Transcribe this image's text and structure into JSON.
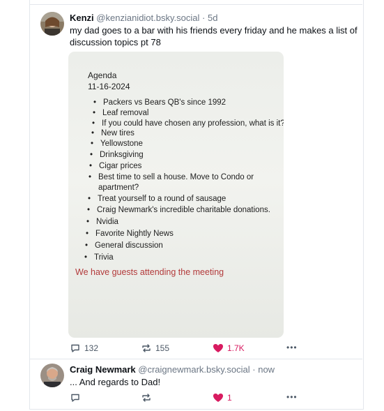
{
  "post": {
    "display_name": "Kenzi",
    "handle": "@kenzianidiot.bsky.social",
    "separator": "·",
    "time": "5d",
    "text_line1": "my dad goes to a bar with his friends every friday and he makes a list of",
    "text_line2": "discussion topics pt 78",
    "image": {
      "title": "Agenda",
      "date": "11-16-2024",
      "items": [
        "Packers vs Bears QB's since 1992",
        "Leaf removal",
        "If you could have chosen any profession, what is it?",
        "New tires",
        "Yellowstone",
        "Drinksgiving",
        "Cigar prices",
        "Best time to sell a house. Move to Condo or",
        "apartment?",
        "Treat yourself to a round of sausage",
        "Craig Newmark's incredible charitable donations.",
        "Nvidia",
        "Favorite Nightly News",
        "General discussion",
        "Trivia"
      ],
      "bullet": "•",
      "footer": "We have guests attending the meeting"
    },
    "actions": {
      "replies": "132",
      "reposts": "155",
      "likes": "1.7K",
      "more": "•••"
    }
  },
  "reply": {
    "display_name": "Craig Newmark",
    "handle": "@craignewmark.bsky.social",
    "separator": "·",
    "time": "now",
    "text": "... And regards to Dad!",
    "actions": {
      "replies": "",
      "reposts": "",
      "likes": "1",
      "more": "•••"
    }
  },
  "colors": {
    "like": "#d81b60",
    "meta": "#6b7684",
    "accent_text": "#b23a3a"
  }
}
